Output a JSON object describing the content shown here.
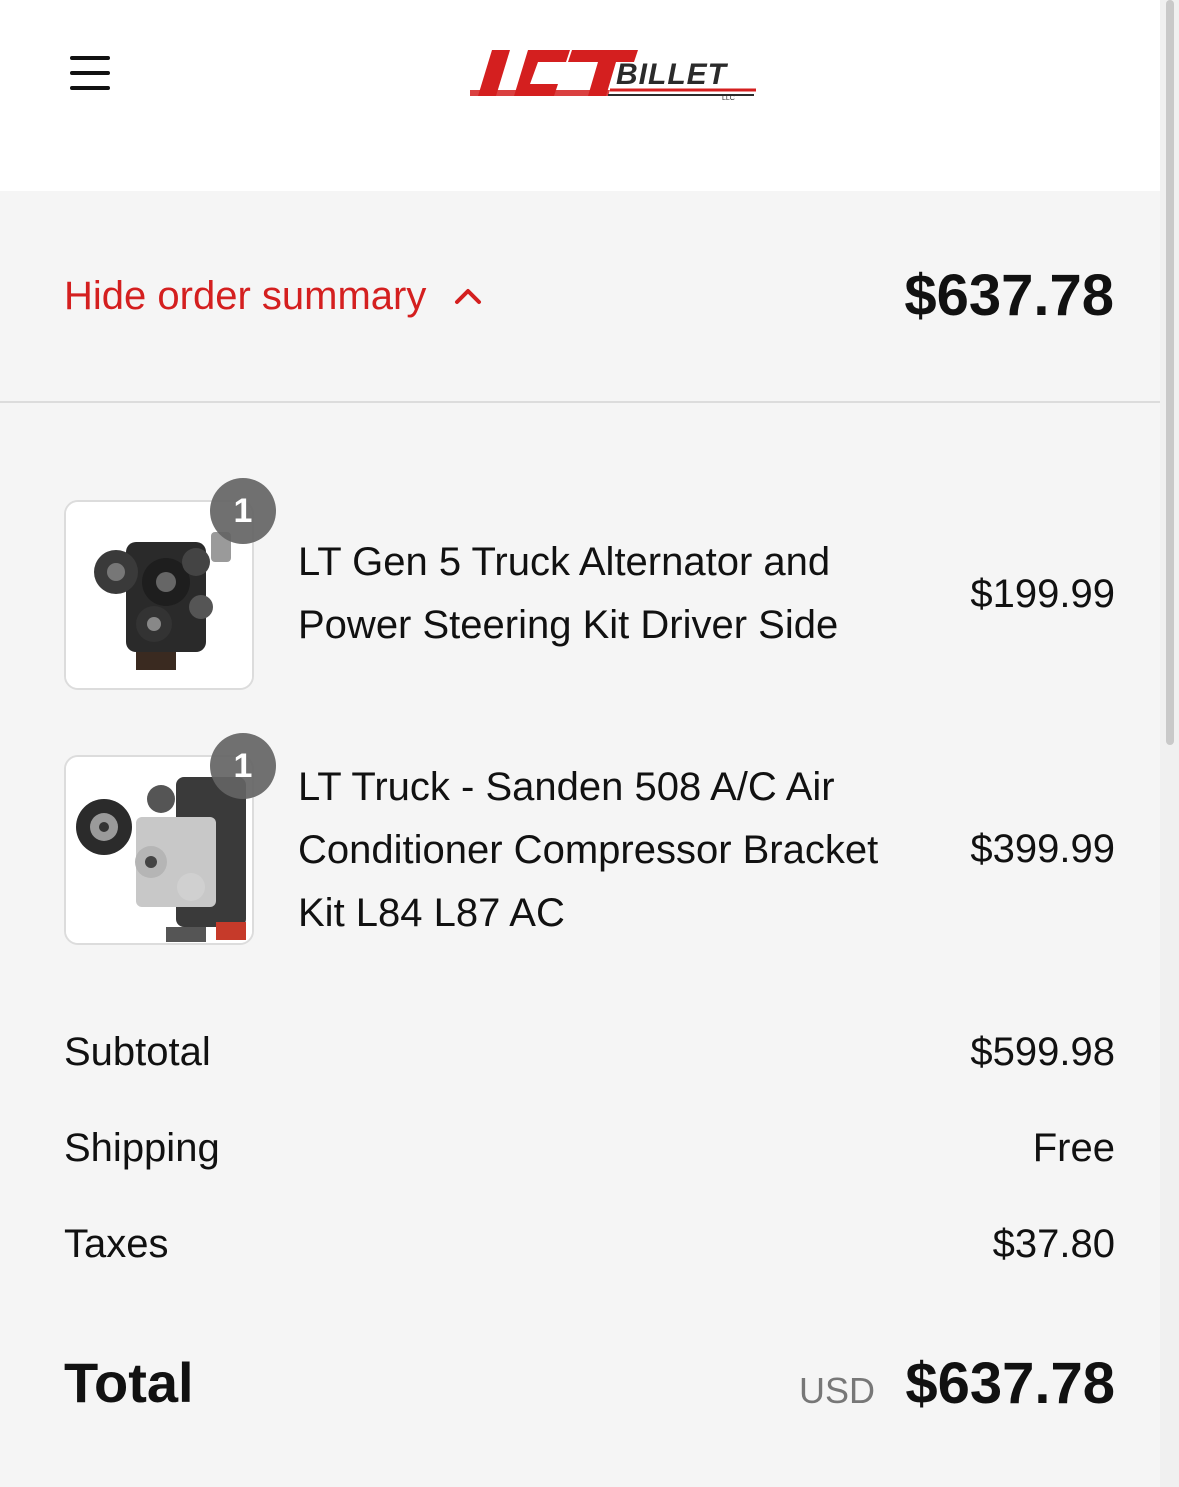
{
  "header": {
    "menu_icon": "hamburger-menu-icon",
    "logo_text": "ICT BILLET LLC",
    "logo_colors": {
      "primary": "#d41f1f",
      "secondary": "#2b2b2b"
    }
  },
  "summary_toggle": {
    "label": "Hide order summary",
    "icon": "chevron-up-icon",
    "total": "$637.78",
    "accent_color": "#d41f1f"
  },
  "items": [
    {
      "quantity": "1",
      "name_lines": [
        "LT Gen 5 Truck Alternator and",
        "Power Steering Kit Driver Side"
      ],
      "price": "$199.99",
      "image": "engine-alternator-kit-image"
    },
    {
      "quantity": "1",
      "name_lines": [
        "LT Truck - Sanden 508 A/C Air",
        "Conditioner Compressor Bracket",
        "Kit L84 L87 AC"
      ],
      "price": "$399.99",
      "image": "ac-compressor-bracket-image"
    }
  ],
  "costs": {
    "subtotal_label": "Subtotal",
    "subtotal_value": "$599.98",
    "shipping_label": "Shipping",
    "shipping_value": "Free",
    "taxes_label": "Taxes",
    "taxes_value": "$37.80"
  },
  "total": {
    "label": "Total",
    "currency": "USD",
    "value": "$637.78"
  }
}
